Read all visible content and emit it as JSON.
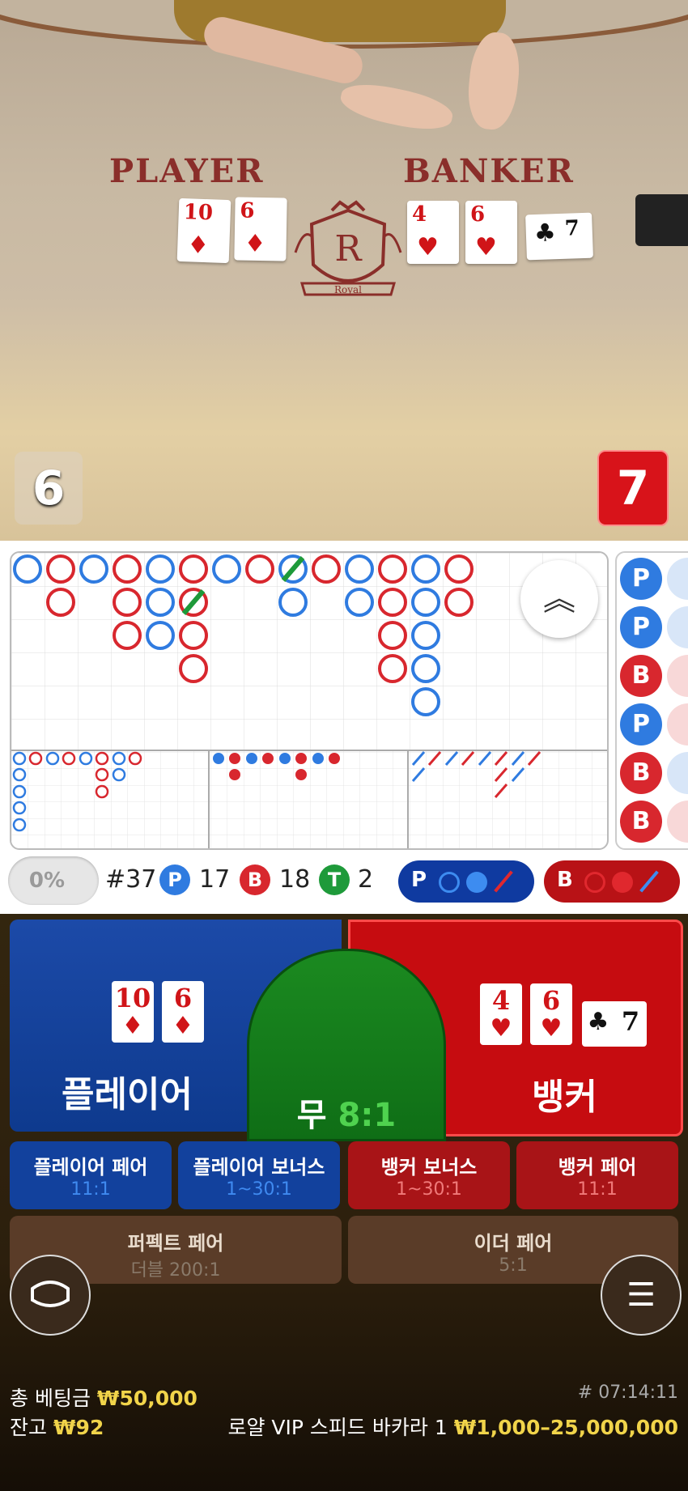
{
  "table": {
    "player_label": "PLAYER",
    "banker_label": "BANKER",
    "player_cards": [
      {
        "rank": "10",
        "suit": "♦"
      },
      {
        "rank": "6",
        "suit": "♦"
      }
    ],
    "banker_cards": [
      {
        "rank": "4",
        "suit": "♥"
      },
      {
        "rank": "6",
        "suit": "♥"
      },
      {
        "rank": "7",
        "suit": "♣"
      }
    ],
    "logo_letter": "R",
    "logo_text": "Royal",
    "player_score": "6",
    "banker_score": "7"
  },
  "scoreboard": {
    "bead_road": [
      "P",
      "P",
      "B",
      "P",
      "B",
      "B"
    ],
    "collapse_icon": "chevron-double-up-icon"
  },
  "stats": {
    "percent": "0%",
    "round": "#37",
    "player_letter": "P",
    "player_count": "17",
    "banker_letter": "B",
    "banker_count": "18",
    "tie_letter": "T",
    "tie_count": "2",
    "predict_player": "P",
    "predict_banker": "B"
  },
  "bets": {
    "player": {
      "label": "플레이어",
      "cards": [
        {
          "rank": "10",
          "suit": "♦"
        },
        {
          "rank": "6",
          "suit": "♦"
        }
      ]
    },
    "tie": {
      "label": "무",
      "odds": "8:1"
    },
    "banker": {
      "label": "뱅커",
      "cards": [
        {
          "rank": "4",
          "suit": "♥"
        },
        {
          "rank": "6",
          "suit": "♥"
        },
        {
          "rank": "7",
          "suit": "♣"
        }
      ]
    },
    "side": [
      {
        "label": "플레이어 페어",
        "odds": "11:1"
      },
      {
        "label": "플레이어 보너스",
        "odds": "1~30:1"
      },
      {
        "label": "뱅커 보너스",
        "odds": "1~30:1"
      },
      {
        "label": "뱅커 페어",
        "odds": "11:1"
      }
    ],
    "perfect_pair": {
      "label": "퍼펙트 페어",
      "odds": "더블 200:1"
    },
    "either_pair": {
      "label": "이더 페어",
      "odds": "5:1"
    }
  },
  "footer": {
    "total_bet_label": "총 베팅금",
    "total_bet_value": "₩50,000",
    "balance_label": "잔고",
    "balance_value": "₩92",
    "round_id": "# 07:14:11",
    "table_name": "로얄 VIP 스피드 바카라 1",
    "limits": "₩1,000–25,000,000"
  },
  "colors": {
    "player": "#1c4aa8",
    "banker": "#c60c10",
    "tie": "#1b8a20",
    "accent": "#f1d44a"
  }
}
